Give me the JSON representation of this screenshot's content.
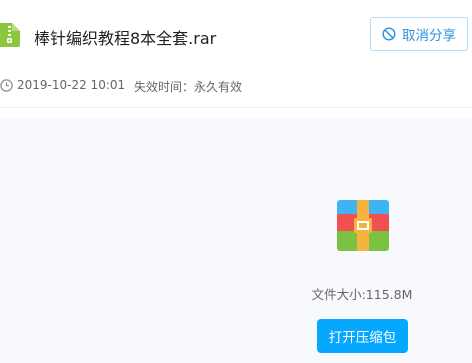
{
  "file": {
    "title": "棒针编织教程8本全套.rar",
    "icon": "zip-file-icon",
    "icon_color": "#8cc63f"
  },
  "header": {
    "cancel_share_label": "取消分享",
    "cancel_icon": "ban-icon",
    "accent_color": "#2a94e0"
  },
  "meta": {
    "share_date": "2019-10-22 10:01",
    "expire_text": "失效时间：永久有效",
    "clock_icon": "clock-icon"
  },
  "preview": {
    "archive_icon": "rar-archive-icon",
    "file_size_text": "文件大小:115.8M",
    "open_button_label": "打开压缩包",
    "button_color": "#06a7ff"
  }
}
